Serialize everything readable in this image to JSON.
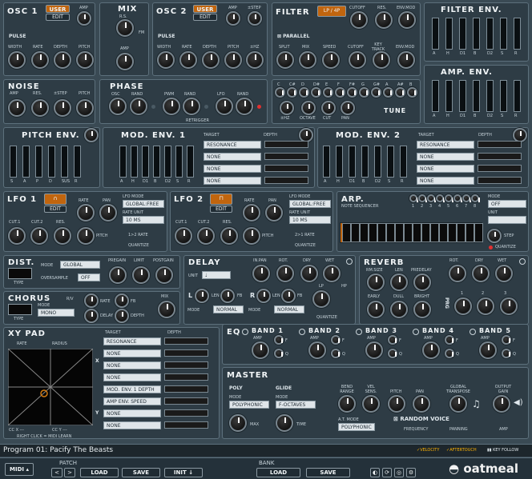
{
  "osc1": {
    "title": "OSC 1",
    "preset": "USER",
    "edit": "EDIT",
    "amp": "AMP",
    "pulse": "PULSE",
    "width": "WIDTH",
    "rate": "RATE",
    "depth": "DEPTH",
    "pitch": "PITCH"
  },
  "mix": {
    "title": "MIX",
    "rs": "R.S.",
    "fm": "FM",
    "amp": "AMP"
  },
  "osc2": {
    "title": "OSC 2",
    "preset": "USER",
    "edit": "EDIT",
    "amp": "AMP",
    "step": "±STEP",
    "pulse": "PULSE",
    "width": "WIDTH",
    "rate": "RATE",
    "depth": "DEPTH",
    "pitch": "PITCH",
    "hz": "±HZ"
  },
  "filter": {
    "title": "FILTER",
    "type": "LP",
    "pole": "4P",
    "cutoff": "CUTOFF",
    "res": "RES.",
    "envmod": "ENV.MOD",
    "parallel": "PARALLEL",
    "split": "SPLIT",
    "mix": "MIX",
    "speed": "SPEED",
    "cutoff2": "CUTOFF",
    "keytrack": "KEY TRACK",
    "envmod2": "ENV.MOD"
  },
  "filter_env": {
    "title": "FILTER ENV.",
    "labels": [
      "A",
      "H",
      "D1",
      "B",
      "D2",
      "S",
      "R"
    ],
    "levels": [
      0.1,
      0.8,
      0.6,
      0.2,
      0.4,
      0.5,
      0.5
    ]
  },
  "amp_env": {
    "title": "AMP. ENV.",
    "labels": [
      "A",
      "H",
      "D1",
      "B",
      "D2",
      "S",
      "R"
    ],
    "levels": [
      0.0,
      0.0,
      0.0,
      0.0,
      0.05,
      0.3,
      0.1
    ]
  },
  "noise": {
    "title": "NOISE",
    "amp": "AMP",
    "res": "RES.",
    "step": "±STEP",
    "pitch": "PITCH"
  },
  "phase": {
    "title": "PHASE",
    "osc": "OSC",
    "rand": "RAND",
    "pwm": "PWM",
    "rand2": "RAND",
    "lfo": "LFO",
    "rand3": "RAND",
    "retrigger": "RETRIGGER"
  },
  "tune": {
    "notes": [
      "C",
      "C#",
      "D",
      "D#",
      "E",
      "F",
      "F#",
      "G",
      "G#",
      "A",
      "A#",
      "B"
    ],
    "hz": "±HZ",
    "octave": "OCTAVE",
    "cut": "CUT",
    "pan": "PAN",
    "title": "TUNE"
  },
  "pitch_env": {
    "title": "PITCH ENV.",
    "labels": [
      "S",
      "A",
      "P",
      "D",
      "SUS",
      "R"
    ],
    "levels": [
      0.9,
      0.6,
      0.3,
      0.0,
      0.0,
      0.1
    ]
  },
  "mod_env1": {
    "title": "MOD. ENV. 1",
    "labels": [
      "A",
      "H",
      "D1",
      "B",
      "D2",
      "S",
      "R"
    ],
    "levels": [
      0.0,
      0.3,
      0.8,
      0.5,
      0.2,
      0.3,
      0.5
    ],
    "target": "TARGET",
    "depth": "DEPTH",
    "targets": [
      "RESONANCE",
      "NONE",
      "NONE",
      "NONE"
    ],
    "depths": [
      0.9,
      0.6,
      0.6,
      0.6
    ]
  },
  "mod_env2": {
    "title": "MOD. ENV. 2",
    "labels": [
      "A",
      "H",
      "D1",
      "B",
      "D2",
      "S",
      "R"
    ],
    "levels": [
      0.1,
      0.8,
      0.5,
      0.4,
      0.3,
      0.5,
      0.5
    ],
    "target": "TARGET",
    "depth": "DEPTH",
    "targets": [
      "RESONANCE",
      "NONE",
      "NONE",
      "NONE"
    ],
    "depths": [
      0.3,
      0.6,
      0.6,
      0.6
    ]
  },
  "lfo1": {
    "title": "LFO 1",
    "edit": "EDIT",
    "rate": "RATE",
    "pan": "PAN",
    "mode_label": "LFO MODE",
    "mode": "GLOBAL:FREE",
    "unit_label": "RATE UNIT",
    "unit": "10 MS",
    "cut1": "CUT.1",
    "cut2": "CUT.2",
    "res": "RES.",
    "pitch": "PITCH",
    "link": "1>2 RATE",
    "quantize": "QUANTIZE"
  },
  "lfo2": {
    "title": "LFO 2",
    "edit": "EDIT",
    "rate": "RATE",
    "pan": "PAN",
    "mode_label": "LFO MODE",
    "mode": "GLOBAL:FREE",
    "unit_label": "RATE UNIT",
    "unit": "10 MS",
    "cut1": "CUT.1",
    "cut2": "CUT.2",
    "res": "RES.",
    "pitch": "PITCH",
    "link": "2>1 RATE",
    "quantize": "QUANTIZE"
  },
  "arp": {
    "title": "ARP.",
    "seq": "NOTE SEQUENCER",
    "mode_label": "MODE",
    "mode": "OFF",
    "unit_label": "UNIT",
    "step": "STEP",
    "quantize": "QUANTIZE",
    "steps": [
      "1",
      "2",
      "3",
      "4",
      "5",
      "6",
      "7",
      "8"
    ]
  },
  "dist": {
    "title": "DIST.",
    "type": "TYPE",
    "mode_label": "MODE",
    "mode": "GLOBAL",
    "over_label": "OVERSAMPLE",
    "over": "OFF",
    "pregain": "PREGAIN",
    "limit": "LIMIT",
    "postgain": "POSTGAIN"
  },
  "chorus": {
    "title": "CHORUS",
    "type": "TYPE",
    "mode_label": "MODE",
    "mode": "MONO",
    "rate": "RATE",
    "fb": "FB",
    "delay": "DELAY",
    "depth": "DEPTH",
    "mix": "MIX",
    "link": "R/V"
  },
  "delay": {
    "title": "DELAY",
    "inpan": "IN.PAN",
    "rot": "ROT.",
    "dry": "DRY",
    "wet": "WET",
    "unit": "UNIT",
    "l": "L",
    "r": "R",
    "len": "LEN",
    "fb": "FB",
    "lp": "LP",
    "hp": "HP",
    "quantize": "QUANTIZE",
    "normal1": "NORMAL",
    "normal2": "NORMAL",
    "mode": "MODE"
  },
  "reverb": {
    "title": "REVERB",
    "rmsize": "RM.SIZE",
    "len": "LEN",
    "predelay": "PREDELAY",
    "rot": "ROT.",
    "dry": "DRY",
    "wet": "WET",
    "early": "EARLY",
    "dull": "DULL",
    "bright": "BRIGHT",
    "prg": "PRG",
    "n1": "1",
    "n2": "2",
    "n3": "3"
  },
  "xy": {
    "title": "XY PAD",
    "rate": "RATE",
    "radius": "RADIUS",
    "target": "TARGET",
    "depth": "DEPTH",
    "x": "X",
    "y": "Y",
    "ccx": "CC X",
    "ccy": "CC Y",
    "ccxv": "---",
    "ccyv": "---",
    "hint": "RIGHT CLICK = MIDI LEARN",
    "targets": [
      "RESONANCE",
      "NONE",
      "NONE",
      "NONE",
      "MOD. ENV. 1 DEPTH",
      "AMP ENV. SPEED",
      "NONE",
      "NONE"
    ],
    "depths": [
      0.95,
      0.6,
      0.6,
      0.6,
      0.1,
      0.6,
      0.6,
      0.6
    ]
  },
  "eq": {
    "title": "EQ",
    "bands": [
      "BAND 1",
      "BAND 2",
      "BAND 3",
      "BAND 4",
      "BAND 5"
    ],
    "amp": "AMP",
    "f": "F",
    "q": "Q"
  },
  "master": {
    "title": "MASTER",
    "poly": "POLY",
    "glide": "GLIDE",
    "mode": "MODE",
    "poly_mode": "POLYPHONIC",
    "glide_mode": "F-OCTAVES",
    "max": "MAX",
    "time": "TIME",
    "bend": "BEND RANGE",
    "vel": "VEL SENS.",
    "pitch": "PITCH",
    "pan": "PAN",
    "gt": "GLOBAL TRANSPOSE",
    "gain": "OUTPUT GAIN",
    "atmode": "A.T. MODE",
    "atval": "POLYPHONIC",
    "random": "RANDOM VOICE",
    "freq": "FREQUENCY",
    "panning": "PANNING",
    "ampl": "AMP"
  },
  "status": {
    "program": "Program 01: Pacify The Beasts",
    "velocity": "VELOCITY",
    "aftertouch": "AFTERTOUCH",
    "keyfollow": "KEY FOLLOW"
  },
  "toolbar": {
    "midi": "MIDI",
    "patch": "PATCH",
    "bank": "BANK",
    "load": "LOAD",
    "save": "SAVE",
    "init": "INIT",
    "load2": "LOAD",
    "save2": "SAVE",
    "logo": "oatmeal"
  },
  "colors": {
    "accent": "#c1650e",
    "panel": "#2e3c45",
    "bg": "#3a4a54",
    "led": "#e23030"
  }
}
